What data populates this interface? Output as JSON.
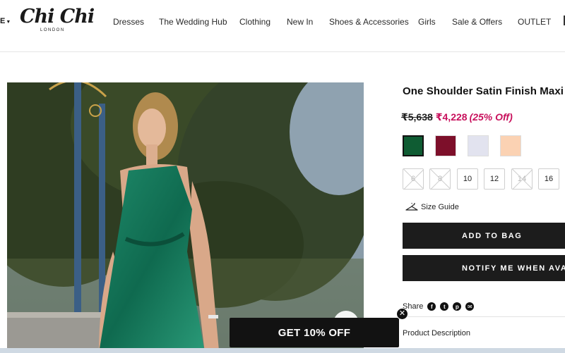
{
  "header": {
    "region_label": "E",
    "logo": {
      "main": "Chi Chi",
      "sub": "LONDON"
    },
    "nav": [
      {
        "label": "Dresses"
      },
      {
        "label": "The Wedding Hub"
      },
      {
        "label": "Clothing"
      },
      {
        "label": "New In"
      },
      {
        "label": "Shoes & Accessories"
      },
      {
        "label": "Girls"
      },
      {
        "label": "Sale & Offers"
      },
      {
        "label": "OUTLET"
      }
    ]
  },
  "product": {
    "title": "One Shoulder Satin Finish Maxi D",
    "price": {
      "old": "₹5,638",
      "new": "₹4,228",
      "discount": "(25% Off)"
    },
    "colors": [
      {
        "name": "green",
        "hex": "#0f5c33",
        "selected": true
      },
      {
        "name": "burgundy",
        "hex": "#7d0f2a",
        "selected": false
      },
      {
        "name": "lilac",
        "hex": "#e2e3ef",
        "selected": false
      },
      {
        "name": "peach",
        "hex": "#fbd2b3",
        "selected": false
      }
    ],
    "sizes": [
      {
        "label": "6",
        "available": false
      },
      {
        "label": "8",
        "available": false
      },
      {
        "label": "10",
        "available": true
      },
      {
        "label": "12",
        "available": true
      },
      {
        "label": "14",
        "available": false
      },
      {
        "label": "16",
        "available": true
      }
    ],
    "size_guide_label": "Size Guide",
    "add_to_bag_label": "ADD TO BAG",
    "notify_label": "NOTIFY ME WHEN AVAILA",
    "share_label": "Share",
    "share_icons": [
      "facebook-icon",
      "twitter-icon",
      "pinterest-icon",
      "email-icon"
    ],
    "description_label": "Product Description"
  },
  "promo": {
    "label": "GET 10% OFF",
    "close_glyph": "✕"
  },
  "colors": {
    "accent_price": "#c8105c",
    "button_bg": "#1c1c1c"
  }
}
